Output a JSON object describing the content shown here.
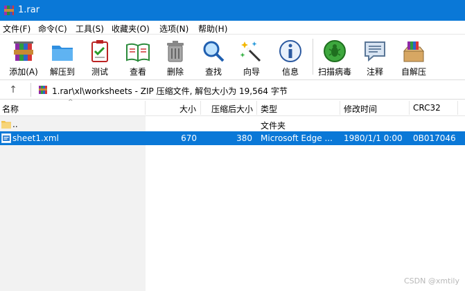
{
  "window": {
    "title": "1.rar",
    "title_color": "#0a78d7"
  },
  "menubar": {
    "items": [
      "文件(F)",
      "命令(C)",
      "工具(S)",
      "收藏夹(O)",
      "选项(N)",
      "帮助(H)"
    ]
  },
  "toolbar": {
    "buttons": [
      {
        "label": "添加(A)",
        "icon": "add-archive-icon"
      },
      {
        "label": "解压到",
        "icon": "extract-to-icon"
      },
      {
        "label": "测试",
        "icon": "test-icon"
      },
      {
        "label": "查看",
        "icon": "view-icon"
      },
      {
        "label": "删除",
        "icon": "delete-icon"
      },
      {
        "label": "查找",
        "icon": "find-icon"
      },
      {
        "label": "向导",
        "icon": "wizard-icon"
      },
      {
        "label": "信息",
        "icon": "info-icon"
      },
      {
        "label": "扫描病毒",
        "icon": "virus-scan-icon"
      },
      {
        "label": "注释",
        "icon": "comment-icon"
      },
      {
        "label": "自解压",
        "icon": "sfx-icon"
      }
    ]
  },
  "addressbar": {
    "up_icon": "up-arrow-icon",
    "path": "1.rar\\xl\\worksheets - ZIP 压缩文件, 解包大小为 19,564 字节"
  },
  "list": {
    "columns": [
      "名称",
      "大小",
      "压缩后大小",
      "类型",
      "修改时间",
      "CRC32"
    ],
    "rows": [
      {
        "name": "..",
        "size": "",
        "packed": "",
        "type": "文件夹",
        "modified": "",
        "crc": "",
        "icon": "folder-icon",
        "selected": false
      },
      {
        "name": "sheet1.xml",
        "size": "670",
        "packed": "380",
        "type": "Microsoft Edge ...",
        "modified": "1980/1/1 0:00",
        "crc": "0B017046",
        "icon": "xml-file-icon",
        "selected": true
      }
    ],
    "selection_color": "#0a78d7"
  },
  "watermark": "CSDN @xmtily"
}
